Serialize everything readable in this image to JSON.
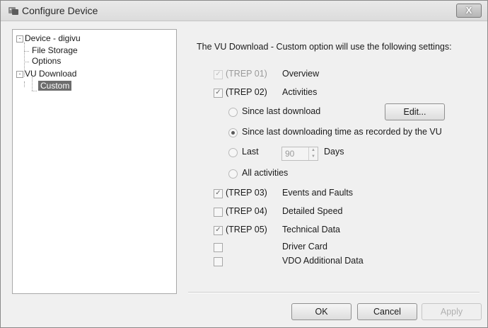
{
  "window": {
    "title": "Configure Device",
    "close_label": "X"
  },
  "tree": {
    "device": {
      "label": "Device - digivu",
      "expander": "-"
    },
    "file_storage": {
      "label": "File Storage"
    },
    "options": {
      "label": "Options"
    },
    "vu_download": {
      "label": "VU Download",
      "expander": "-"
    },
    "custom": {
      "label": "Custom"
    }
  },
  "content": {
    "heading": "The VU Download - Custom option will use the following settings:",
    "trep01": {
      "code": "(TREP 01)",
      "label": "Overview",
      "checked": true,
      "enabled": false
    },
    "trep02": {
      "code": "(TREP 02)",
      "label": "Activities",
      "checked": true,
      "enabled": true
    },
    "activities": {
      "since_last_download": "Since last download",
      "since_last_downloading_time": "Since last downloading time as recorded by the VU",
      "last": "Last",
      "last_days_value": "90",
      "days": "Days",
      "all_activities": "All activities",
      "selected": "since_last_downloading_time"
    },
    "edit_button": "Edit...",
    "trep03": {
      "code": "(TREP 03)",
      "label": "Events and Faults",
      "checked": true
    },
    "trep04": {
      "code": "(TREP 04)",
      "label": "Detailed Speed",
      "checked": false
    },
    "trep05": {
      "code": "(TREP 05)",
      "label": "Technical Data",
      "checked": true
    },
    "driver_card": {
      "label": "Driver Card",
      "checked": false
    },
    "vdo_additional": {
      "label": "VDO Additional Data",
      "checked": false
    },
    "check_mark": "✓"
  },
  "buttons": {
    "ok": "OK",
    "cancel": "Cancel",
    "apply": "Apply"
  },
  "colors": {
    "selection": "#6d6d6d",
    "window_bg": "#f0f0f0"
  }
}
